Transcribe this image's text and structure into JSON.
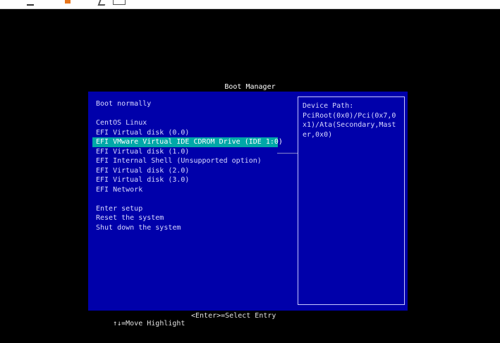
{
  "title": "Boot Manager",
  "menu": {
    "items": [
      {
        "label": "Boot normally",
        "selected": false
      },
      {
        "label": "",
        "selected": false
      },
      {
        "label": "CentOS Linux",
        "selected": false
      },
      {
        "label": "EFI Virtual disk (0.0)",
        "selected": false
      },
      {
        "label": "EFI VMware Virtual IDE CDROM Drive (IDE 1:0)",
        "selected": true
      },
      {
        "label": "EFI Virtual disk (1.0)",
        "selected": false
      },
      {
        "label": "EFI Internal Shell (Unsupported option)",
        "selected": false
      },
      {
        "label": "EFI Virtual disk (2.0)",
        "selected": false
      },
      {
        "label": "EFI Virtual disk (3.0)",
        "selected": false
      },
      {
        "label": "EFI Network",
        "selected": false
      },
      {
        "label": "",
        "selected": false
      },
      {
        "label": "Enter setup",
        "selected": false
      },
      {
        "label": "Reset the system",
        "selected": false
      },
      {
        "label": "Shut down the system",
        "selected": false
      }
    ]
  },
  "help": {
    "text": "Device Path:\nPciRoot(0x0)/Pci(0x7,0x1)/Ata(Secondary,Master,0x0)"
  },
  "footer": {
    "move_hint": "↑↓=Move Highlight",
    "select_hint": "<Enter>=Select Entry"
  },
  "colors": {
    "panel_bg": "#0000aa",
    "highlight_bg": "#00a8a8",
    "screen_bg": "#000000"
  }
}
